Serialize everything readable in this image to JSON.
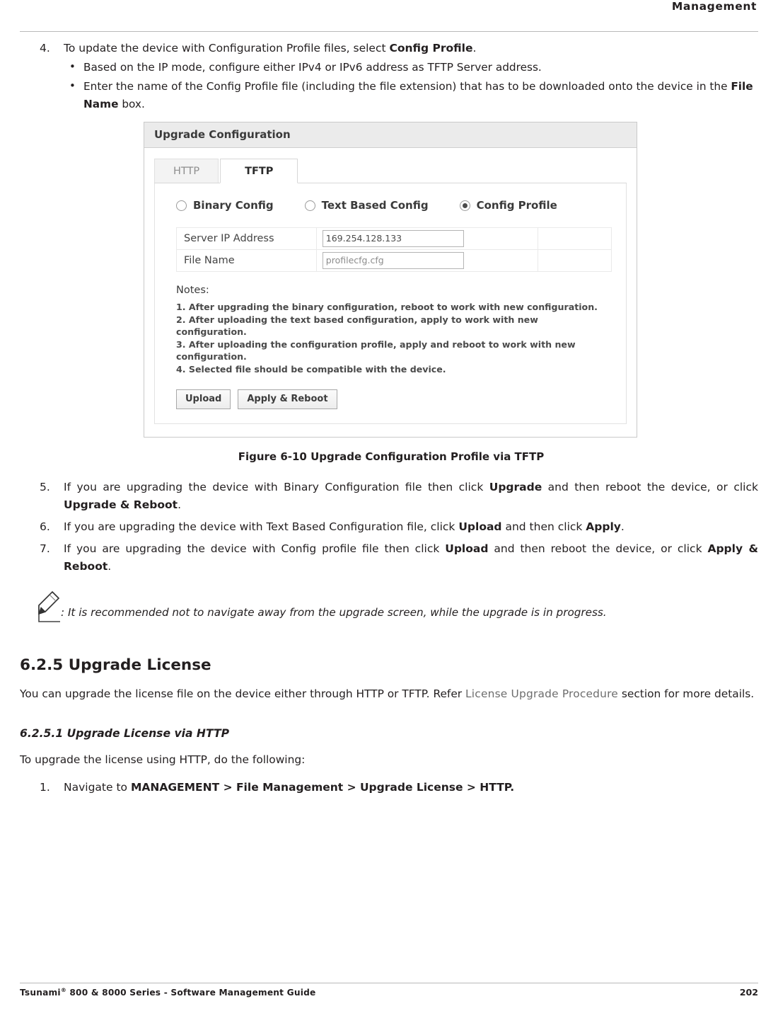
{
  "header": {
    "title": "Management"
  },
  "steps": {
    "step4": {
      "num": "4.",
      "text_before": "To update the device with Configuration Profile files, select ",
      "bold": "Config Profile",
      "text_after": "."
    },
    "bullet1": "Based on the IP mode, configure either IPv4 or IPv6 address as TFTP Server address.",
    "bullet2_before": "Enter the name of the Config Profile file (including the file extension) that has to be downloaded onto the device in the ",
    "bullet2_bold": "File Name",
    "bullet2_after": " box.",
    "step5": {
      "num": "5.",
      "t1": "If you are upgrading the device with Binary Configuration file then click ",
      "b1": "Upgrade",
      "t2": " and then reboot the device, or click ",
      "b2": "Upgrade & Reboot",
      "t3": "."
    },
    "step6": {
      "num": "6.",
      "t1": "If you are upgrading the device with Text Based Configuration file, click ",
      "b1": "Upload",
      "t2": " and then click ",
      "b2": "Apply",
      "t3": "."
    },
    "step7": {
      "num": "7.",
      "t1": "If you are upgrading the device with Config profile file then click ",
      "b1": "Upload",
      "t2": " and then reboot the device, or click ",
      "b2": "Apply & Reboot",
      "t3": "."
    },
    "step1_license": {
      "num": "1.",
      "t1": "Navigate to ",
      "b1": "MANAGEMENT > File Management > Upgrade License > HTTP."
    }
  },
  "figure": {
    "window_title": "Upgrade Configuration",
    "tabs": [
      {
        "label": "HTTP",
        "active": false
      },
      {
        "label": "TFTP",
        "active": true
      }
    ],
    "radios": [
      {
        "label": "Binary Config",
        "selected": false
      },
      {
        "label": "Text Based Config",
        "selected": false
      },
      {
        "label": "Config Profile",
        "selected": true
      }
    ],
    "fields": [
      {
        "label": "Server IP Address",
        "value": "169.254.128.133"
      },
      {
        "label": "File Name",
        "value": "profilecfg.cfg"
      }
    ],
    "notes_label": "Notes:",
    "notes": [
      "1. After upgrading the binary configuration, reboot to work with new configuration.",
      "2. After uploading the text based configuration, apply to work with new configuration.",
      "3. After uploading the configuration profile, apply and reboot to work with new configuration.",
      "4. Selected file should be compatible with the device."
    ],
    "buttons": [
      {
        "label": "Upload"
      },
      {
        "label": "Apply & Reboot"
      }
    ],
    "caption": "Figure 6-10 Upgrade Configuration Profile via TFTP"
  },
  "note": {
    "text": ": It is recommended not to navigate away from the upgrade screen, while the upgrade is in progress."
  },
  "section": {
    "heading": "6.2.5 Upgrade License",
    "para_before": "You can upgrade the license file on the device either through HTTP or TFTP. Refer ",
    "para_link": "License Upgrade Procedure",
    "para_after": " section for more details.",
    "subheading": "6.2.5.1 Upgrade License via HTTP",
    "subpara": "To upgrade the license using HTTP, do the following:"
  },
  "footer": {
    "left_pre": "Tsunami",
    "left_sup": "®",
    "left_post": " 800 & 8000 Series - Software Management Guide",
    "page": "202"
  }
}
